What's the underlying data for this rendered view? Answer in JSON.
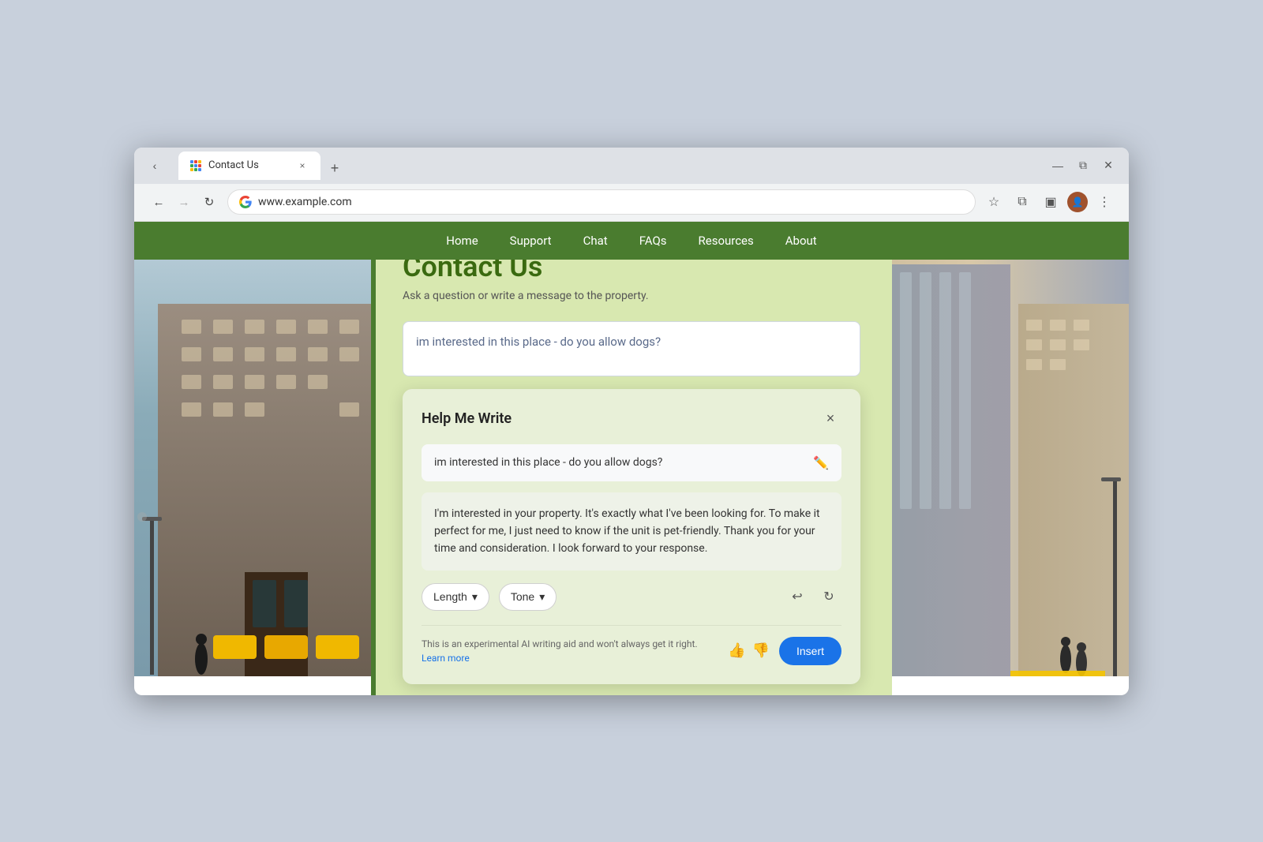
{
  "browser": {
    "tab": {
      "favicon_label": "waffle",
      "title": "Contact Us",
      "close_label": "×"
    },
    "new_tab_label": "+",
    "controls": {
      "minimize": "—",
      "maximize": "⧉",
      "close": "✕"
    },
    "nav": {
      "back_label": "←",
      "forward_label": "→",
      "reload_label": "↻"
    },
    "address": "www.example.com",
    "icons": {
      "star": "☆",
      "extensions": "⊞",
      "sidebar": "⊟",
      "more": "⋮"
    }
  },
  "site_nav": {
    "items": [
      {
        "label": "Home",
        "href": "#"
      },
      {
        "label": "Support",
        "href": "#"
      },
      {
        "label": "Chat",
        "href": "#"
      },
      {
        "label": "FAQs",
        "href": "#"
      },
      {
        "label": "Resources",
        "href": "#"
      },
      {
        "label": "About",
        "href": "#"
      }
    ]
  },
  "page": {
    "title": "Contact Us",
    "subtitle": "Ask a question or write a message to the property.",
    "textarea_value": "im interested in this place - do you allow dogs?"
  },
  "help_write": {
    "title": "Help Me Write",
    "close_label": "×",
    "input_text": "im interested in this place - do you allow dogs?",
    "generated_text": "I'm interested in your property. It's exactly what I've been looking for. To make it perfect for me, I just need to know if the unit is pet-friendly. Thank you for your time and consideration. I look forward to your response.",
    "length_label": "Length",
    "tone_label": "Tone",
    "dropdown_arrow": "▾",
    "footer_text": "This is an experimental AI writing aid and won't always get it right.",
    "learn_more_label": "Learn more",
    "insert_label": "Insert"
  }
}
